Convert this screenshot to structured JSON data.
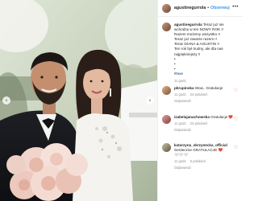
{
  "post": {
    "username": "agustinegurrola",
    "separator": "•",
    "follow_label": "Obserwuj",
    "more_label": "•••",
    "nav_prev": "‹",
    "nav_next": "›"
  },
  "caption": {
    "username": "agustinegurrola",
    "lines": [
      "Teraz już nie ",
      "wchodzę w ten NOWY ROK !!",
      "Razem możemy wszystko !!",
      "Teraz już zawsze razem !!",
      "Teraz DIANA & AGUSTIN !!",
      "Ten rok był trudny, ale dla nas",
      "najpiękniejszy !!"
    ],
    "first_line_suffix": "Teraz jużnie ",
    "dots": "•",
    "hashtag": "#love",
    "time": "11 godz."
  },
  "comments": [
    {
      "username": "pkrupinska",
      "text": "Wow.. Gratulacje",
      "extra": "",
      "time": "11 godz.",
      "likes": "23 polubień",
      "reply": "Odpowiedz"
    },
    {
      "username": "izabelajanachowska",
      "text": "Gratulacje ❤️",
      "extra": "",
      "time": "11 godz.",
      "likes": "23 polubień",
      "reply": "Odpowiedz"
    },
    {
      "username": "katarzyna_skrzynecka_official",
      "text": "Serdeczne GRATULACJE ❤️",
      "extra": "🤍🤍🤍",
      "time": "11 godz.",
      "likes": "6 polubień",
      "reply": "Odpowiedz"
    }
  ],
  "heart_icon": "♡"
}
